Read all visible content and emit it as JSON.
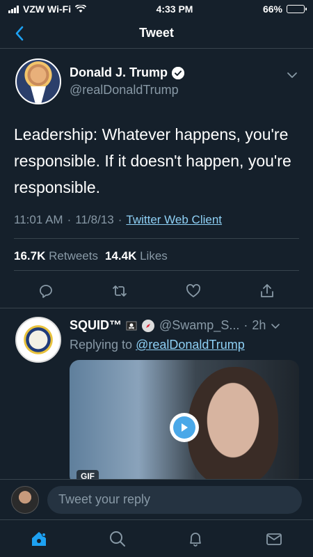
{
  "status_bar": {
    "carrier": "VZW Wi-Fi",
    "time": "4:33 PM",
    "battery": "66%",
    "battery_level": 0.66
  },
  "header": {
    "title": "Tweet"
  },
  "tweet": {
    "author_name": "Donald J. Trump",
    "author_handle": "@realDonaldTrump",
    "text": "Leadership: Whatever happens, you're responsible. If it doesn't happen, you're responsible.",
    "time": "11:01 AM",
    "date": "11/8/13",
    "source": "Twitter Web Client",
    "retweets_count": "16.7K",
    "retweets_label": "Retweets",
    "likes_count": "14.4K",
    "likes_label": "Likes"
  },
  "reply": {
    "author_name": "SQUID™",
    "author_handle": "@Swamp_S...",
    "age": "2h",
    "replying_label": "Replying to",
    "replying_handle": "@realDonaldTrump",
    "media_badge": "GIF"
  },
  "composer": {
    "placeholder": "Tweet your reply"
  },
  "colors": {
    "background": "#15202b",
    "accent": "#1da1f2",
    "muted": "#8899a6",
    "link": "#8ed0f5",
    "divider": "#38444d"
  },
  "icons": {
    "back": "chevron-left-icon",
    "verified": "verified-badge-icon",
    "menu": "chevron-down-icon",
    "reply": "comment-icon",
    "retweet": "retweet-icon",
    "like": "heart-icon",
    "share": "share-icon",
    "home": "home-icon",
    "search": "search-icon",
    "notifications": "bell-icon",
    "messages": "mail-icon"
  }
}
